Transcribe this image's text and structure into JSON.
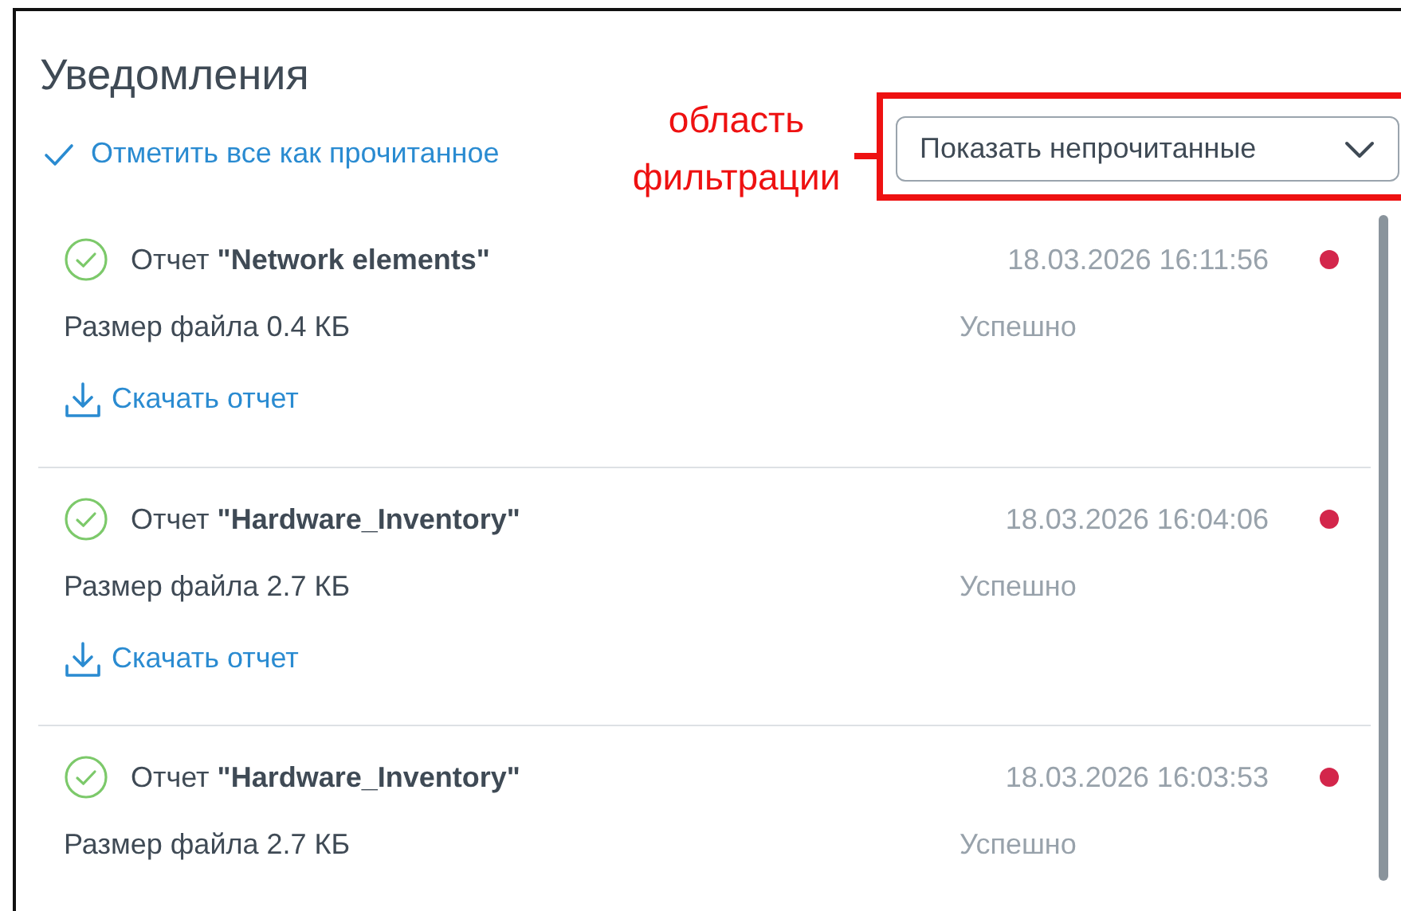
{
  "panel": {
    "title": "Уведомления",
    "mark_all_read": "Отметить все как прочитанное",
    "filter": {
      "value": "Показать непрочитанные"
    }
  },
  "annotation": {
    "label": "область фильтрации"
  },
  "notifications": [
    {
      "title": "Отчет **\"Network elements\"**",
      "time": "18.03.2026 16:11:56",
      "unread": true,
      "size": "Размер файла 0.4 КБ",
      "status": "Успешно",
      "download": "Скачать отчет"
    },
    {
      "title": "Отчет **\"Hardware_Inventory\"**",
      "time": "18.03.2026 16:04:06",
      "unread": true,
      "size": "Размер файла 2.7 КБ",
      "status": "Успешно",
      "download": "Скачать отчет"
    },
    {
      "title": "Отчет **\"Hardware_Inventory\"**",
      "time": "18.03.2026 16:03:53",
      "unread": true,
      "size": "Размер файла 2.7 КБ",
      "status": "Успешно"
    }
  ]
}
